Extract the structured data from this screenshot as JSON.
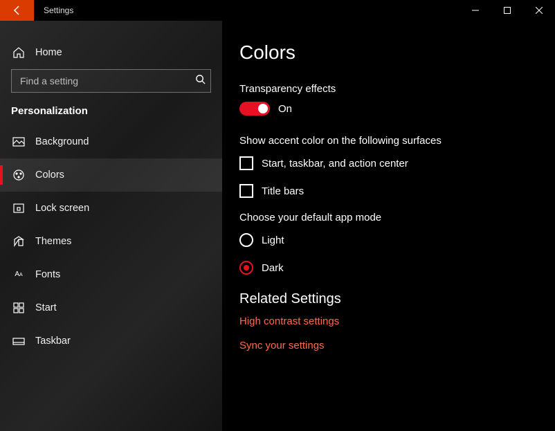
{
  "titlebar": {
    "app_title": "Settings"
  },
  "sidebar": {
    "home_label": "Home",
    "search_placeholder": "Find a setting",
    "section_title": "Personalization",
    "items": [
      {
        "label": "Background"
      },
      {
        "label": "Colors"
      },
      {
        "label": "Lock screen"
      },
      {
        "label": "Themes"
      },
      {
        "label": "Fonts"
      },
      {
        "label": "Start"
      },
      {
        "label": "Taskbar"
      }
    ]
  },
  "page": {
    "title": "Colors",
    "transparency": {
      "label": "Transparency effects",
      "state": "On"
    },
    "accent_surfaces": {
      "heading": "Show accent color on the following surfaces",
      "option1": "Start, taskbar, and action center",
      "option2": "Title bars"
    },
    "app_mode": {
      "heading": "Choose your default app mode",
      "option_light": "Light",
      "option_dark": "Dark"
    },
    "related": {
      "heading": "Related Settings",
      "link1": "High contrast settings",
      "link2": "Sync your settings"
    }
  }
}
